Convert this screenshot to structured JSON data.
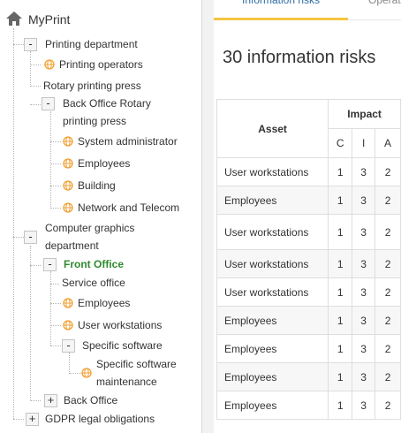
{
  "tree": {
    "root": "MyPrint",
    "nodes": {
      "printing_department": "Printing department",
      "printing_operators": "Printing operators",
      "rotary_printing_press": "Rotary printing press",
      "back_office_rotary": "Back Office Rotary printing press",
      "system_administrator": "System administrator",
      "employees": "Employees",
      "building": "Building",
      "network_telecom": "Network and Telecom",
      "computer_graphics": "Computer graphics department",
      "front_office": "Front Office",
      "service_office": "Service office",
      "employees2": "Employees",
      "user_workstations": "User workstations",
      "specific_software": "Specific software",
      "specific_software_maintenance": "Specific software maintenance",
      "back_office": "Back Office",
      "gdpr": "GDPR legal obligations"
    },
    "toggles": {
      "expanded": "-",
      "collapsed": "+"
    }
  },
  "tabs": {
    "active": "Information risks",
    "second": "Operational risks"
  },
  "risks": {
    "count_title": "30 information risks",
    "headers": {
      "asset": "Asset",
      "impact": "Impact",
      "c": "C",
      "i": "I",
      "a": "A"
    },
    "rows": [
      {
        "asset": "User workstations",
        "c": "1",
        "i": "3",
        "a": "2"
      },
      {
        "asset": "Employees",
        "c": "1",
        "i": "3",
        "a": "2"
      },
      {
        "asset": "User workstations",
        "c": "1",
        "i": "3",
        "a": "2"
      },
      {
        "asset": "User workstations",
        "c": "1",
        "i": "3",
        "a": "2"
      },
      {
        "asset": "User workstations",
        "c": "1",
        "i": "3",
        "a": "2"
      },
      {
        "asset": "Employees",
        "c": "1",
        "i": "3",
        "a": "2"
      },
      {
        "asset": "Employees",
        "c": "1",
        "i": "3",
        "a": "2"
      },
      {
        "asset": "Employees",
        "c": "1",
        "i": "3",
        "a": "2"
      },
      {
        "asset": "Employees",
        "c": "1",
        "i": "3",
        "a": "2"
      }
    ]
  },
  "colors": {
    "active_node": "#2e8b2e",
    "tab_underline": "#f4c542",
    "globe": "#f0a030"
  }
}
